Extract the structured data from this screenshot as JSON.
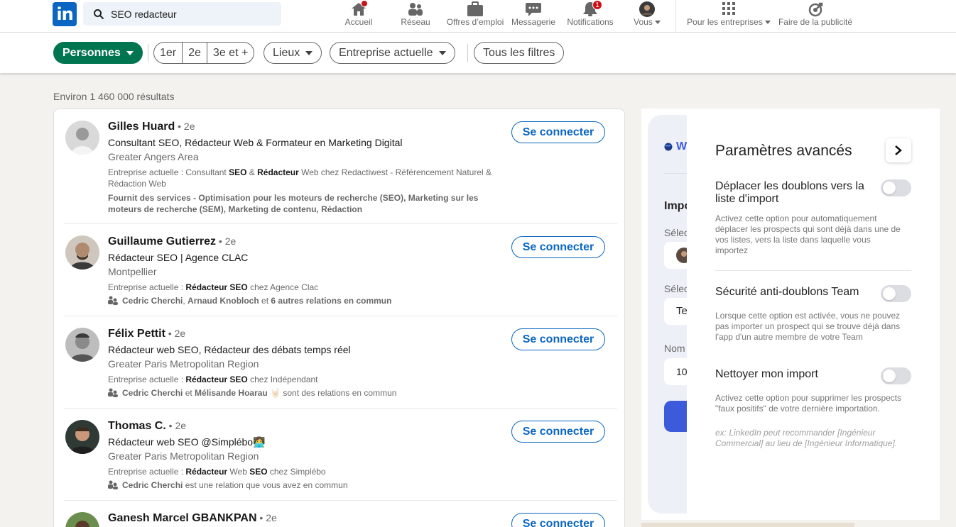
{
  "nav": {
    "search_value": "SEO redacteur",
    "items": [
      {
        "label": "Accueil",
        "icon": "home-icon",
        "badge": ""
      },
      {
        "label": "Réseau",
        "icon": "network-icon",
        "badge": ""
      },
      {
        "label": "Offres d’emploi",
        "icon": "briefcase-icon",
        "badge": ""
      },
      {
        "label": "Messagerie",
        "icon": "message-icon",
        "badge": ""
      },
      {
        "label": "Notifications",
        "icon": "bell-icon",
        "badge": "1"
      },
      {
        "label": "Vous",
        "icon": "avatar",
        "badge": ""
      },
      {
        "label": "Pour les entreprises",
        "icon": "grid-icon",
        "badge": ""
      },
      {
        "label": "Faire de la publicité",
        "icon": "ads-icon",
        "badge": ""
      }
    ]
  },
  "filters": {
    "primary": "Personnes",
    "degrees": [
      "1er",
      "2e",
      "3e et +"
    ],
    "lieux": "Lieux",
    "entreprise": "Entreprise actuelle",
    "all": "Tous les filtres"
  },
  "results_count": "Environ 1 460 000 résultats",
  "connect_label": "Se connecter",
  "people": [
    {
      "name": "Gilles Huard",
      "degree": " • 2e",
      "headline": "Consultant SEO, Rédacteur Web & Formateur en Marketing Digital",
      "location": "Greater Angers Area",
      "company_prefix": "Entreprise actuelle  : Consultant ",
      "company_b1": "SEO",
      "company_mid": " & ",
      "company_b2": "Rédacteur",
      "company_rest": " Web chez Redactiwest - Référencement Naturel & Rédaction Web",
      "services": "Fournit des services - Optimisation pour les moteurs de recherche (SEO), Marketing sur les moteurs de recherche (SEM), Marketing de contenu, Rédaction"
    },
    {
      "name": "Guillaume Gutierrez",
      "degree": " • 2e",
      "headline": "Rédacteur SEO | Agence CLAC",
      "location": "Montpellier",
      "company_prefix": "Entreprise actuelle  : ",
      "company_b1": "Rédacteur SEO",
      "company_rest": " chez Agence Clac",
      "mutual_a": "Cedric Cherchi",
      "mutual_sep1": ", ",
      "mutual_b": "Arnaud Knobloch",
      "mutual_sep2": " et ",
      "mutual_c": "6 autres relations en commun"
    },
    {
      "name": "Félix Pettit",
      "degree": " • 2e",
      "headline": "Rédacteur web SEO, Rédacteur des débats temps réel",
      "location": "Greater Paris Metropolitan Region",
      "company_prefix": "Entreprise actuelle  : ",
      "company_b1": "Rédacteur SEO",
      "company_rest": " chez Indépendant",
      "mutual_a": "Cedric Cherchi",
      "mutual_sep1": " et ",
      "mutual_b": "Mélisande Hoarau 🤘🏻",
      "mutual_sep2": " sont des relations en commun"
    },
    {
      "name": "Thomas C.",
      "degree": " • 2e",
      "headline": "Rédacteur web SEO @Simplébo👩‍💻",
      "location": "Greater Paris Metropolitan Region",
      "company_prefix": "Entreprise actuelle  : ",
      "company_b1": "Rédacteur",
      "company_mid": " Web ",
      "company_b2": "SEO",
      "company_rest": " chez Simplébo",
      "mutual_a": "Cedric Cherchi",
      "mutual_sep1": " est une relation que vous avez en commun"
    },
    {
      "name": "Ganesh Marcel GBANKPAN",
      "degree": " • 2e"
    }
  ],
  "extension": {
    "frag_w": "W",
    "frag_imp": "Impo",
    "frag_sel1": "Sélec",
    "frag_sel2": "Sélec",
    "frag_te": "Te",
    "frag_nom": "Nom",
    "frag_10": "10"
  },
  "panel": {
    "title": "Paramètres avancés",
    "options": [
      {
        "title": "Déplacer les doublons vers la liste d'import",
        "desc": "Activez cette option pour automatiquement déplacer les prospects qui sont déjà dans une de vos listes, vers la liste dans laquelle vous importez",
        "enabled": false
      },
      {
        "title": "Sécurité anti-doublons Team",
        "desc": "Lorsque cette option est activée, vous ne pouvez pas importer un prospect qui se trouve déjà dans l'app d'un autre membre de votre Team",
        "enabled": false
      },
      {
        "title": "Nettoyer mon import",
        "desc": "Activez cette option pour supprimer les prospects \"faux positifs\" de votre dernière importation.",
        "example": "ex: LinkedIn peut recommander [Ingénieur Commercial] au lieu de [Ingénieur Informatique].",
        "enabled": false
      }
    ]
  },
  "colors": {
    "linkedin_blue": "#0a66c2",
    "filter_green": "#01754f",
    "badge_red": "#cc1016",
    "extension_button": "#3b5bdb"
  }
}
